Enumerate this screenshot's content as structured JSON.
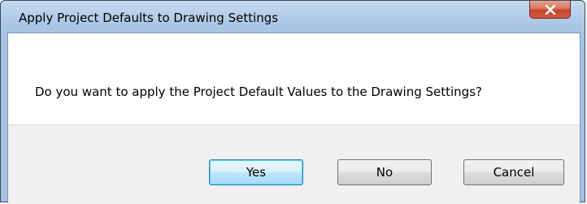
{
  "dialog": {
    "title": "Apply Project Defaults to Drawing Settings",
    "message": "Do you want to apply the Project Default Values to the Drawing Settings?",
    "close_icon": "close-icon",
    "buttons": {
      "yes_label": "Yes",
      "no_label": "No",
      "cancel_label": "Cancel"
    },
    "default_button": "Yes"
  },
  "colors": {
    "title_bar": "#a9c5e4",
    "close_button": "#c7432a",
    "default_button_border": "#3c7fb1",
    "button_area": "#f0f0f0"
  }
}
